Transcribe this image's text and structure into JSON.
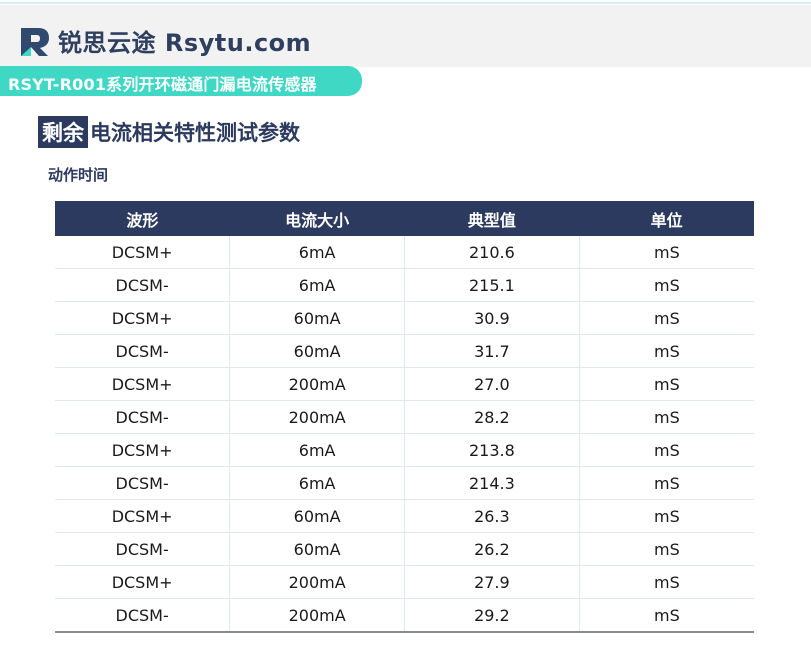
{
  "header": {
    "brand": "锐思云途 Rsytu.com",
    "product_title": "RSYT-R001系列开环磁通门漏电流传感器"
  },
  "section": {
    "title_highlight": "剩余",
    "title_rest": "电流相关特性测试参数",
    "subtitle": "动作时间"
  },
  "table": {
    "headers": [
      "波形",
      "电流大小",
      "典型值",
      "单位"
    ],
    "rows": [
      [
        "DCSM+",
        "6mA",
        "210.6",
        "mS"
      ],
      [
        "DCSM-",
        "6mA",
        "215.1",
        "mS"
      ],
      [
        "DCSM+",
        "60mA",
        "30.9",
        "mS"
      ],
      [
        "DCSM-",
        "60mA",
        "31.7",
        "mS"
      ],
      [
        "DCSM+",
        "200mA",
        "27.0",
        "mS"
      ],
      [
        "DCSM-",
        "200mA",
        "28.2",
        "mS"
      ],
      [
        "DCSM+",
        "6mA",
        "213.8",
        "mS"
      ],
      [
        "DCSM-",
        "6mA",
        "214.3",
        "mS"
      ],
      [
        "DCSM+",
        "60mA",
        "26.3",
        "mS"
      ],
      [
        "DCSM-",
        "60mA",
        "26.2",
        "mS"
      ],
      [
        "DCSM+",
        "200mA",
        "27.9",
        "mS"
      ],
      [
        "DCSM-",
        "200mA",
        "29.2",
        "mS"
      ]
    ]
  },
  "colors": {
    "navy": "#2b3a5e",
    "teal": "#3fd8c4",
    "header_bg": "#f2f2f2"
  },
  "icons": {
    "logo": "rsytu-logo-icon"
  }
}
